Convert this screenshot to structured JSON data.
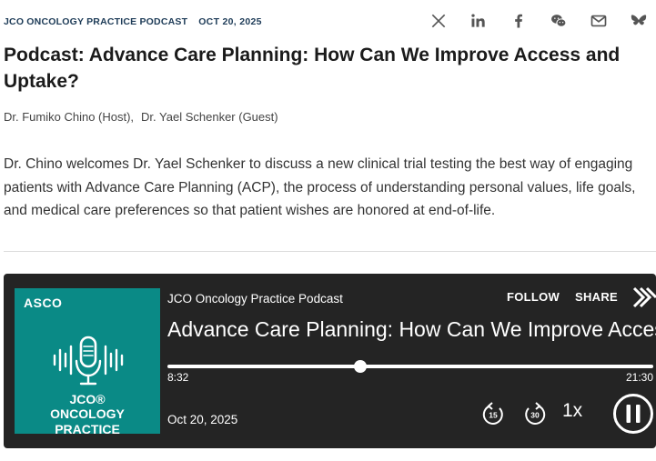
{
  "meta": {
    "kicker": "JCO ONCOLOGY PRACTICE PODCAST",
    "date": "OCT 20, 2025"
  },
  "share_icons": [
    "x-icon",
    "linkedin-icon",
    "facebook-icon",
    "wechat-icon",
    "email-icon",
    "bluesky-icon"
  ],
  "article": {
    "title": "Podcast: Advance Care Planning: How Can We Improve Access and Uptake?",
    "authors": [
      "Dr. Fumiko Chino (Host),",
      "Dr. Yael Schenker (Guest)"
    ],
    "description": "Dr. Chino welcomes Dr. Yael Schenker to discuss a new clinical trial testing the best way of engaging patients with Advance Care Planning (ACP), the process of understanding personal values, life goals, and medical care preferences so that patient wishes are honored at end-of-life."
  },
  "player": {
    "artwork": {
      "brand": "ASCO",
      "line1": "JCO®",
      "line2": "ONCOLOGY",
      "line3": "PRACTICE"
    },
    "show_name": "JCO Oncology Practice Podcast",
    "follow_label": "FOLLOW",
    "share_label": "SHARE",
    "episode_title": "Advance Care Planning: How Can We Improve Access and Uptake?",
    "current_time": "8:32",
    "total_time": "21:30",
    "progress_fraction": 0.397,
    "pub_date": "Oct 20, 2025",
    "rewind_seconds": "15",
    "forward_seconds": "30",
    "speed": "1x",
    "colors": {
      "background": "#242424",
      "artwork": "#0a8a86",
      "text": "#ffffff"
    }
  }
}
